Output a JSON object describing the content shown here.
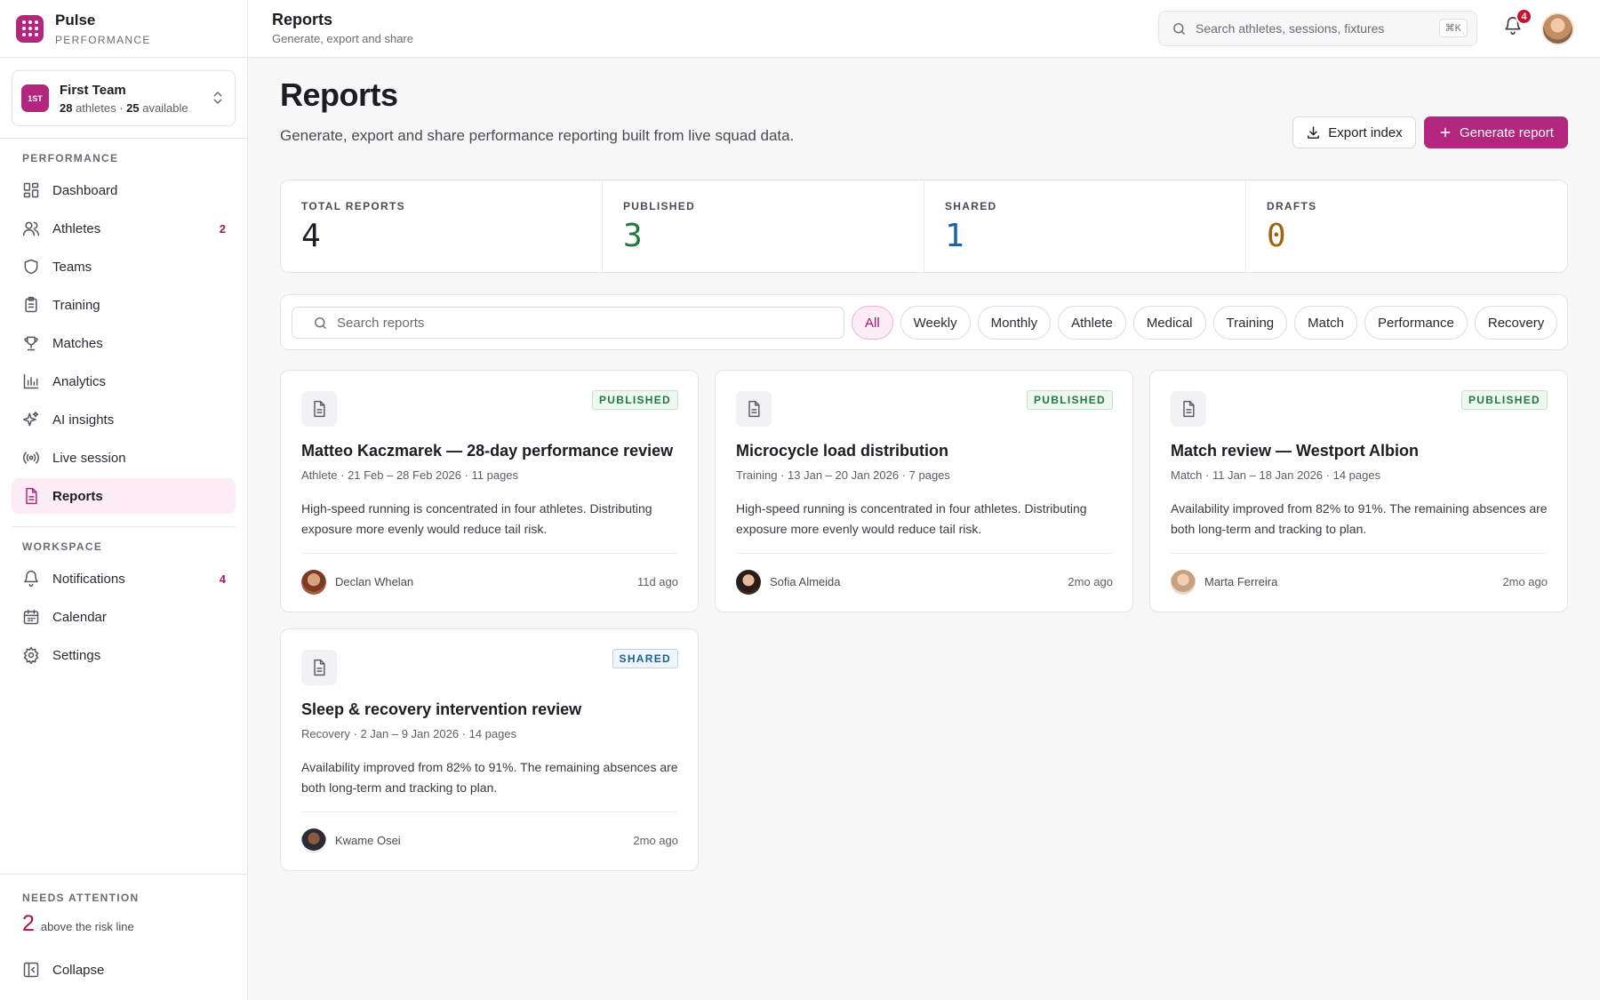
{
  "brand": {
    "name": "Pulse",
    "subtitle": "PERFORMANCE"
  },
  "team": {
    "badge": "1ST",
    "name": "First Team",
    "athletes": "28",
    "athletes_suffix": " athletes · ",
    "available": "25",
    "available_suffix": " available"
  },
  "sidebar": {
    "performance_label": "PERFORMANCE",
    "performance_items": [
      {
        "label": "Dashboard",
        "icon": "dashboard-icon"
      },
      {
        "label": "Athletes",
        "icon": "users-icon",
        "count": "2"
      },
      {
        "label": "Teams",
        "icon": "shield-icon"
      },
      {
        "label": "Training",
        "icon": "clipboard-icon"
      },
      {
        "label": "Matches",
        "icon": "trophy-icon"
      },
      {
        "label": "Analytics",
        "icon": "bar-chart-icon"
      },
      {
        "label": "AI insights",
        "icon": "sparkle-icon"
      },
      {
        "label": "Live session",
        "icon": "broadcast-icon"
      },
      {
        "label": "Reports",
        "icon": "document-icon",
        "active": true
      }
    ],
    "workspace_label": "WORKSPACE",
    "workspace_items": [
      {
        "label": "Notifications",
        "icon": "bell-icon",
        "count": "4"
      },
      {
        "label": "Calendar",
        "icon": "calendar-icon"
      },
      {
        "label": "Settings",
        "icon": "gear-icon"
      }
    ],
    "attention_label": "NEEDS ATTENTION",
    "attention_count": "2",
    "attention_text": "above the risk line",
    "collapse_label": "Collapse"
  },
  "topbar": {
    "title": "Reports",
    "subtitle": "Generate, export and share",
    "search_placeholder": "Search athletes, sessions, fixtures",
    "shortcut": "⌘K",
    "notification_count": "4"
  },
  "page": {
    "title": "Reports",
    "description": "Generate, export and share performance reporting built from live squad data.",
    "export_label": "Export index",
    "generate_label": "Generate report"
  },
  "stats": [
    {
      "label": "TOTAL REPORTS",
      "value": "4",
      "color": "#1c1c22"
    },
    {
      "label": "PUBLISHED",
      "value": "3",
      "color": "#1e7a3c"
    },
    {
      "label": "SHARED",
      "value": "1",
      "color": "#1d63a6"
    },
    {
      "label": "DRAFTS",
      "value": "0",
      "color": "#9a6410"
    }
  ],
  "filters": {
    "search_placeholder": "Search reports",
    "chips": [
      "All",
      "Weekly",
      "Monthly",
      "Athlete",
      "Medical",
      "Training",
      "Match",
      "Performance",
      "Recovery"
    ],
    "active": "All"
  },
  "reports": [
    {
      "status": "PUBLISHED",
      "title": "Matteo Kaczmarek — 28-day performance review",
      "meta": "Athlete · 21 Feb – 28 Feb 2026 · 11 pages",
      "body": "High-speed running is concentrated in four athletes. Distributing exposure more evenly would reduce tail risk.",
      "author": "Declan Whelan",
      "time": "11d ago"
    },
    {
      "status": "PUBLISHED",
      "title": "Microcycle load distribution",
      "meta": "Training · 13 Jan – 20 Jan 2026 · 7 pages",
      "body": "High-speed running is concentrated in four athletes. Distributing exposure more evenly would reduce tail risk.",
      "author": "Sofia Almeida",
      "time": "2mo ago"
    },
    {
      "status": "PUBLISHED",
      "title": "Match review — Westport Albion",
      "meta": "Match · 11 Jan – 18 Jan 2026 · 14 pages",
      "body": "Availability improved from 82% to 91%. The remaining absences are both long-term and tracking to plan.",
      "author": "Marta Ferreira",
      "time": "2mo ago"
    },
    {
      "status": "SHARED",
      "title": "Sleep & recovery intervention review",
      "meta": "Recovery · 2 Jan – 9 Jan 2026 · 14 pages",
      "body": "Availability improved from 82% to 91%. The remaining absences are both long-term and tracking to plan.",
      "author": "Kwame Osei",
      "time": "2mo ago"
    }
  ]
}
